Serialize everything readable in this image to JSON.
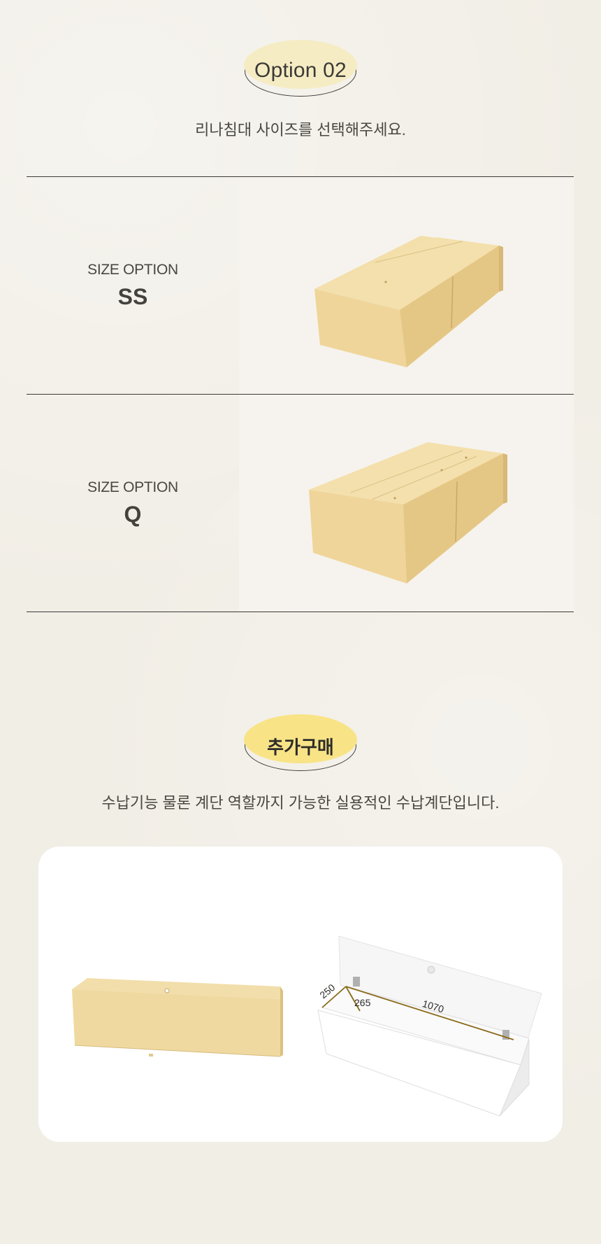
{
  "option_section": {
    "badge_label": "Option 02",
    "subtitle": "리나침대 사이즈를 선택해주세요."
  },
  "size_options": [
    {
      "label": "SIZE OPTION",
      "value": "SS",
      "image": "storage-bed-frame-ss"
    },
    {
      "label": "SIZE OPTION",
      "value": "Q",
      "image": "storage-bed-frame-q"
    }
  ],
  "extra_section": {
    "badge_label": "추가구매",
    "subtitle": "수납기능 물론 계단 역할까지 가능한 실용적인 수납계단입니다.",
    "dimensions": {
      "width": "250",
      "depth": "265",
      "length": "1070"
    }
  },
  "colors": {
    "background": "#f1eee6",
    "badge_option": "#f5ecc4",
    "badge_extra": "#f8e487",
    "wood": "#f0d9a0",
    "dimension_line": "#8a6a1a"
  }
}
